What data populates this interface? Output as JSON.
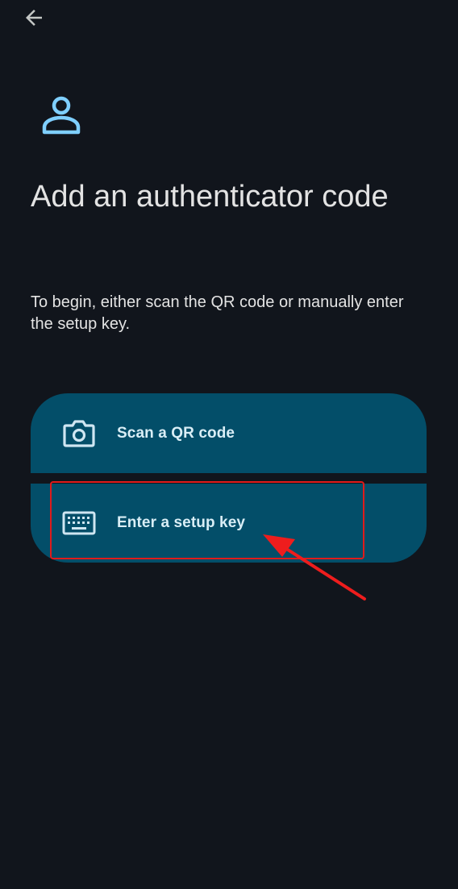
{
  "header": {
    "back_icon": "arrow-left-icon"
  },
  "hero": {
    "icon": "person-icon"
  },
  "title": "Add an authenticator code",
  "description": "To begin, either scan the QR code or manually enter the setup key.",
  "options": [
    {
      "label": "Scan a QR code",
      "icon": "camera-icon"
    },
    {
      "label": "Enter a setup key",
      "icon": "keyboard-icon"
    }
  ],
  "annotation": {
    "highlight_color": "#e01b1b",
    "arrow_color": "#ee1d1d"
  },
  "colors": {
    "background": "#11151c",
    "option_background": "#034e69",
    "accent": "#7fcfff",
    "text": "#e3e3e3"
  }
}
